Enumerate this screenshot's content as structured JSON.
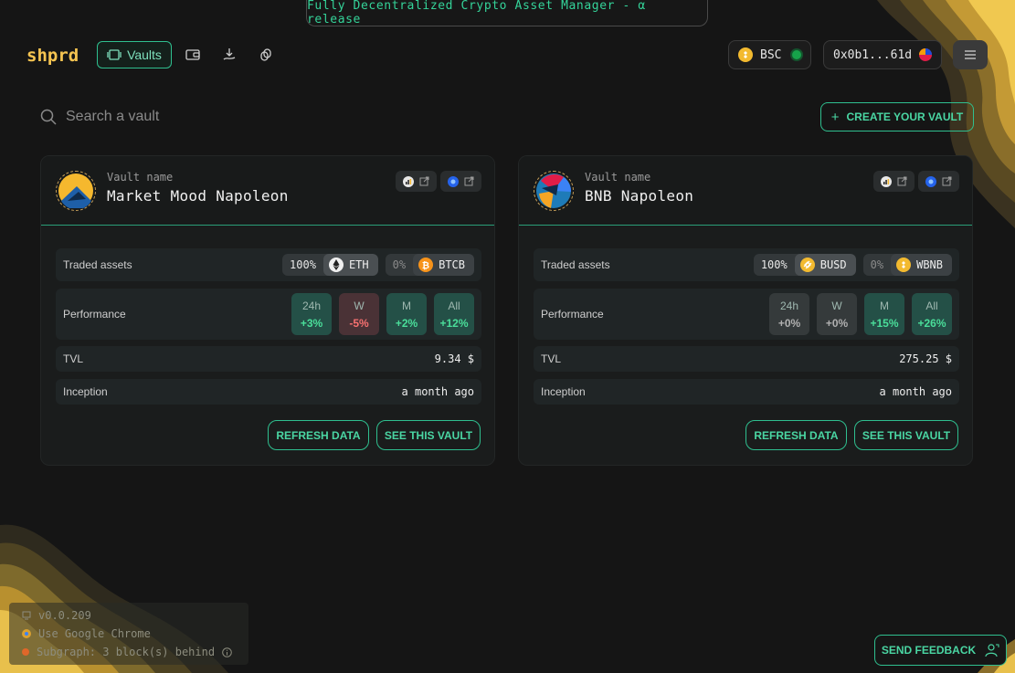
{
  "banner": {
    "text": "Fully Decentralized Crypto Asset Manager - α release"
  },
  "header": {
    "logo": "shprd",
    "nav_vaults_label": "Vaults",
    "network": {
      "label": "BSC",
      "icon": "bnb-icon",
      "status_color": "#22c55e"
    },
    "wallet": {
      "address": "0x0b1...61d",
      "icon": "avatar-pie-icon"
    }
  },
  "search": {
    "placeholder": "Search a vault",
    "value": ""
  },
  "create_button": {
    "label": "CREATE YOUR VAULT",
    "icon": "plus-icon"
  },
  "vaults": [
    {
      "label": "Vault name",
      "name": "Market Mood Napoleon",
      "traded_label": "Traded assets",
      "assets": [
        {
          "pct": "100%",
          "symbol": "ETH",
          "icon": "eth-icon"
        },
        {
          "pct": "0%",
          "symbol": "BTCB",
          "icon": "btc-icon"
        }
      ],
      "performance_label": "Performance",
      "performance": [
        {
          "period": "24h",
          "value": "+3%",
          "trend": "up"
        },
        {
          "period": "W",
          "value": "-5%",
          "trend": "down"
        },
        {
          "period": "M",
          "value": "+2%",
          "trend": "up"
        },
        {
          "period": "All",
          "value": "+12%",
          "trend": "up"
        }
      ],
      "tvl_label": "TVL",
      "tvl": "9.34 $",
      "inception_label": "Inception",
      "inception": "a month ago",
      "refresh_label": "REFRESH DATA",
      "see_label": "SEE THIS VAULT"
    },
    {
      "label": "Vault name",
      "name": "BNB Napoleon",
      "traded_label": "Traded assets",
      "assets": [
        {
          "pct": "100%",
          "symbol": "BUSD",
          "icon": "busd-icon"
        },
        {
          "pct": "0%",
          "symbol": "WBNB",
          "icon": "bnb-icon"
        }
      ],
      "performance_label": "Performance",
      "performance": [
        {
          "period": "24h",
          "value": "+0%",
          "trend": "flat"
        },
        {
          "period": "W",
          "value": "+0%",
          "trend": "flat"
        },
        {
          "period": "M",
          "value": "+15%",
          "trend": "up"
        },
        {
          "period": "All",
          "value": "+26%",
          "trend": "up"
        }
      ],
      "tvl_label": "TVL",
      "tvl": "275.25 $",
      "inception_label": "Inception",
      "inception": "a month ago",
      "refresh_label": "REFRESH DATA",
      "see_label": "SEE THIS VAULT"
    }
  ],
  "status": {
    "version": "v0.0.209",
    "browser": "Use Google Chrome",
    "subgraph": "Subgraph: 3 block(s) behind"
  },
  "feedback": {
    "label": "SEND FEEDBACK",
    "icon": "user-feedback-icon"
  },
  "colors": {
    "accent": "#2fbf8f",
    "brand": "#f5c451",
    "positive": "#4ade9a",
    "negative": "#f87171"
  }
}
